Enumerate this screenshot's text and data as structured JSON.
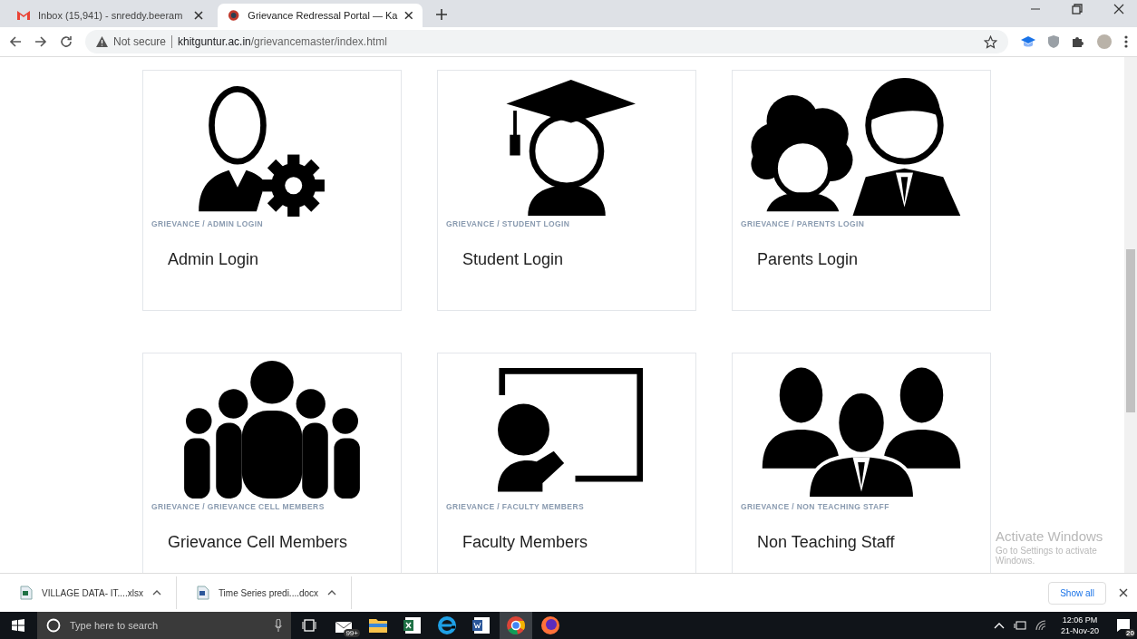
{
  "browser": {
    "tabs": [
      {
        "kind": "mail",
        "title": "Inbox (15,941) - snreddy.beeram",
        "selected": false
      },
      {
        "kind": "portal",
        "title": "Grievance Redressal Portal — Ka",
        "selected": true
      }
    ],
    "address": {
      "security": "Not secure",
      "host": "khitguntur.ac.in",
      "path": "/grievancemaster/index.html"
    }
  },
  "cards": [
    {
      "kind": "admin",
      "breadcrumb": "GRIEVANCE / ADMIN LOGIN",
      "title": "Admin Login"
    },
    {
      "kind": "student",
      "breadcrumb": "GRIEVANCE / STUDENT LOGIN",
      "title": "Student Login"
    },
    {
      "kind": "parents",
      "breadcrumb": "GRIEVANCE / PARENTS LOGIN",
      "title": "Parents Login"
    },
    {
      "kind": "cell",
      "breadcrumb": "GRIEVANCE / GRIEVANCE CELL MEMBERS",
      "title": "Grievance Cell Members"
    },
    {
      "kind": "faculty",
      "breadcrumb": "GRIEVANCE / FACULTY MEMBERS",
      "title": "Faculty Members"
    },
    {
      "kind": "staff",
      "breadcrumb": "GRIEVANCE / NON TEACHING STAFF",
      "title": "Non Teaching Staff"
    }
  ],
  "activation": {
    "title": "Activate Windows",
    "subtitle": "Go to Settings to activate Windows."
  },
  "downloads": [
    {
      "kind": "xlsx",
      "name": "VILLAGE DATA- IT....xlsx"
    },
    {
      "kind": "docx",
      "name": "Time Series predi....docx"
    }
  ],
  "show_all": "Show all",
  "taskbar": {
    "search_placeholder": "Type here to search",
    "apps": [
      {
        "kind": "mail",
        "badge": "99+",
        "selected": false
      },
      {
        "kind": "folder",
        "selected": false
      },
      {
        "kind": "excel",
        "selected": false
      },
      {
        "kind": "ie",
        "selected": false
      },
      {
        "kind": "word",
        "selected": false
      },
      {
        "kind": "chrome",
        "selected": true
      },
      {
        "kind": "firefox",
        "selected": false
      }
    ],
    "time": "12:06 PM",
    "date": "21-Nov-20",
    "notifications": "20"
  }
}
